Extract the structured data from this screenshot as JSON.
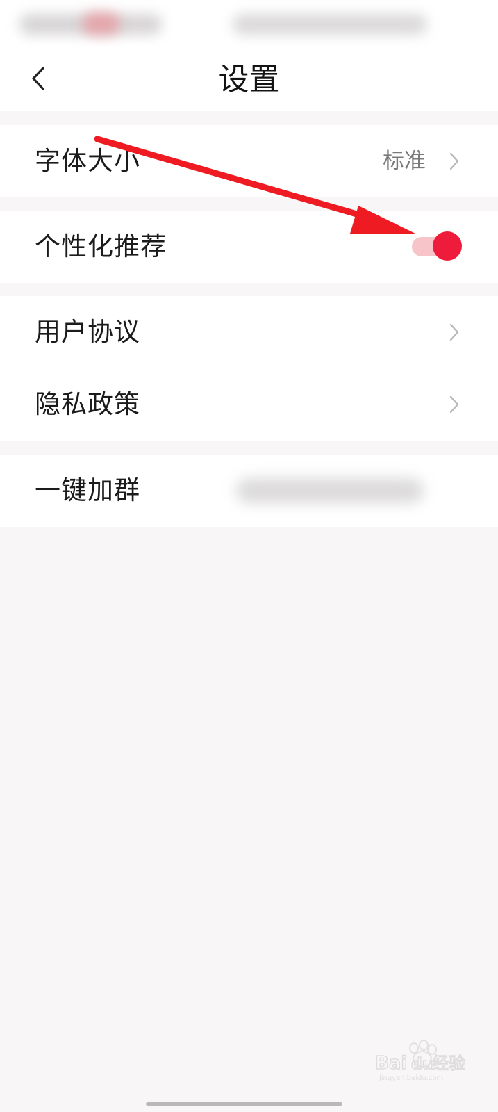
{
  "header": {
    "title": "设置",
    "back_icon": "chevron-left-icon"
  },
  "settings": {
    "font_size": {
      "label": "字体大小",
      "value": "标准"
    },
    "personalized_recommendation": {
      "label": "个性化推荐",
      "enabled": true
    },
    "user_agreement": {
      "label": "用户协议"
    },
    "privacy_policy": {
      "label": "隐私政策"
    },
    "join_group": {
      "label": "一键加群"
    }
  },
  "colors": {
    "accent": "#ee1b3a",
    "toggle_track_on": "#f6c4c9",
    "annotation_arrow": "#ee1b23",
    "page_background": "#f8f6f7"
  },
  "watermark": {
    "text": "Bai du 经验",
    "subtext": "jingyan.baidu.com"
  }
}
